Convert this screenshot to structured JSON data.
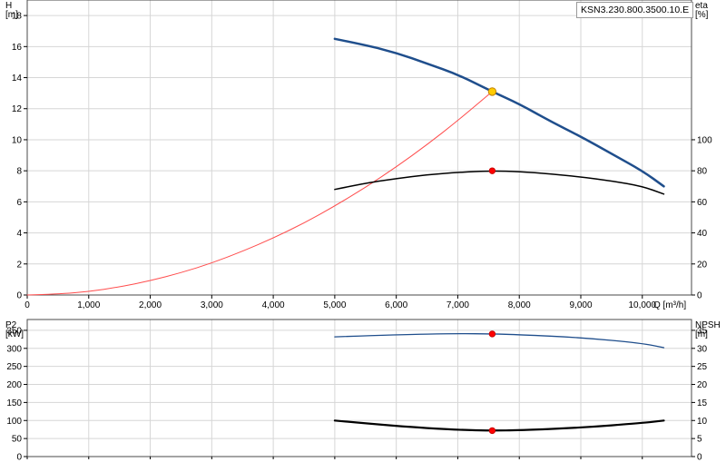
{
  "model_label": "KSN3.230.800.3500.10.E",
  "chart_data": [
    {
      "type": "line",
      "panel": "upper",
      "x_axis": {
        "label": "Q [m³/h]",
        "min": 0,
        "max": 10800,
        "ticks": [
          0,
          1000,
          2000,
          3000,
          4000,
          5000,
          6000,
          7000,
          8000,
          9000,
          10000
        ],
        "tick_labels": [
          "0",
          "1,000",
          "2,000",
          "3,000",
          "4,000",
          "5,000",
          "6,000",
          "7,000",
          "8,000",
          "9,000",
          "10,000"
        ]
      },
      "y_left": {
        "label_line1": "H",
        "label_line2": "[m]",
        "min": 0,
        "max": 19,
        "ticks": [
          0,
          2,
          4,
          6,
          8,
          10,
          12,
          14,
          16,
          18
        ]
      },
      "y_right": {
        "label_line1": "eta",
        "label_line2": "[%]",
        "min": 0,
        "max": 190,
        "ticks": [
          0,
          20,
          40,
          60,
          80,
          100
        ]
      },
      "grid": true,
      "series": [
        {
          "axis": "left",
          "color": "#1f4e8c",
          "width": 2.5,
          "x": [
            5000,
            5500,
            6000,
            6500,
            7000,
            7560,
            8000,
            8500,
            9000,
            9500,
            10000,
            10350
          ],
          "y": [
            16.5,
            16.1,
            15.6,
            14.9,
            14.2,
            13.1,
            12.3,
            11.2,
            10.2,
            9.1,
            8.0,
            7.0
          ]
        },
        {
          "axis": "left",
          "color": "#ff4d4d",
          "width": 1,
          "x": [
            0,
            500,
            1000,
            1500,
            2000,
            2500,
            3000,
            3500,
            4000,
            4500,
            5000,
            5500,
            6000,
            6500,
            7000,
            7560
          ],
          "y": [
            0,
            0.06,
            0.22,
            0.52,
            0.92,
            1.43,
            2.06,
            2.81,
            3.67,
            4.63,
            5.73,
            6.93,
            8.25,
            9.68,
            11.23,
            13.1
          ]
        },
        {
          "axis": "right",
          "color": "#000000",
          "width": 1.5,
          "x": [
            5000,
            5500,
            6000,
            6500,
            7000,
            7560,
            8000,
            8500,
            9000,
            9500,
            10000,
            10350
          ],
          "y": [
            68,
            72,
            75,
            77.5,
            79,
            80,
            79.5,
            78,
            76,
            73.5,
            70,
            65
          ]
        }
      ],
      "markers": [
        {
          "axis": "left",
          "x": 7560,
          "y": 13.1,
          "fill": "#ffcc00",
          "stroke": "#c08000"
        },
        {
          "axis": "right",
          "x": 7560,
          "y": 80,
          "fill": "#ff0000",
          "stroke": "#cc0000"
        }
      ]
    },
    {
      "type": "line",
      "panel": "lower",
      "x_axis": {
        "min": 0,
        "max": 10800
      },
      "y_left": {
        "label_line1": "P2",
        "label_line2": "[kW]",
        "min": 0,
        "max": 380,
        "ticks": [
          0,
          50,
          100,
          150,
          200,
          250,
          300,
          350
        ]
      },
      "y_right": {
        "label_line1": "NPSH",
        "label_line2": "[m]",
        "min": 0,
        "max": 38,
        "ticks": [
          0,
          5,
          10,
          15,
          20,
          25,
          30,
          35
        ]
      },
      "grid": true,
      "series": [
        {
          "axis": "left",
          "color": "#1f4e8c",
          "width": 1.3,
          "x": [
            5000,
            6000,
            7000,
            7560,
            8000,
            9000,
            10000,
            10350
          ],
          "y": [
            332,
            338,
            341,
            340,
            338,
            330,
            314,
            302
          ]
        },
        {
          "axis": "right",
          "color": "#000000",
          "width": 2.2,
          "x": [
            5000,
            6000,
            7000,
            7560,
            8000,
            9000,
            10000,
            10350
          ],
          "y": [
            10,
            8.4,
            7.4,
            7.2,
            7.3,
            8.0,
            9.3,
            10
          ]
        }
      ],
      "markers": [
        {
          "axis": "left",
          "x": 7560,
          "y": 340,
          "fill": "#ff0000",
          "stroke": "#cc0000"
        },
        {
          "axis": "right",
          "x": 7560,
          "y": 7.2,
          "fill": "#ff0000",
          "stroke": "#cc0000"
        }
      ]
    }
  ]
}
